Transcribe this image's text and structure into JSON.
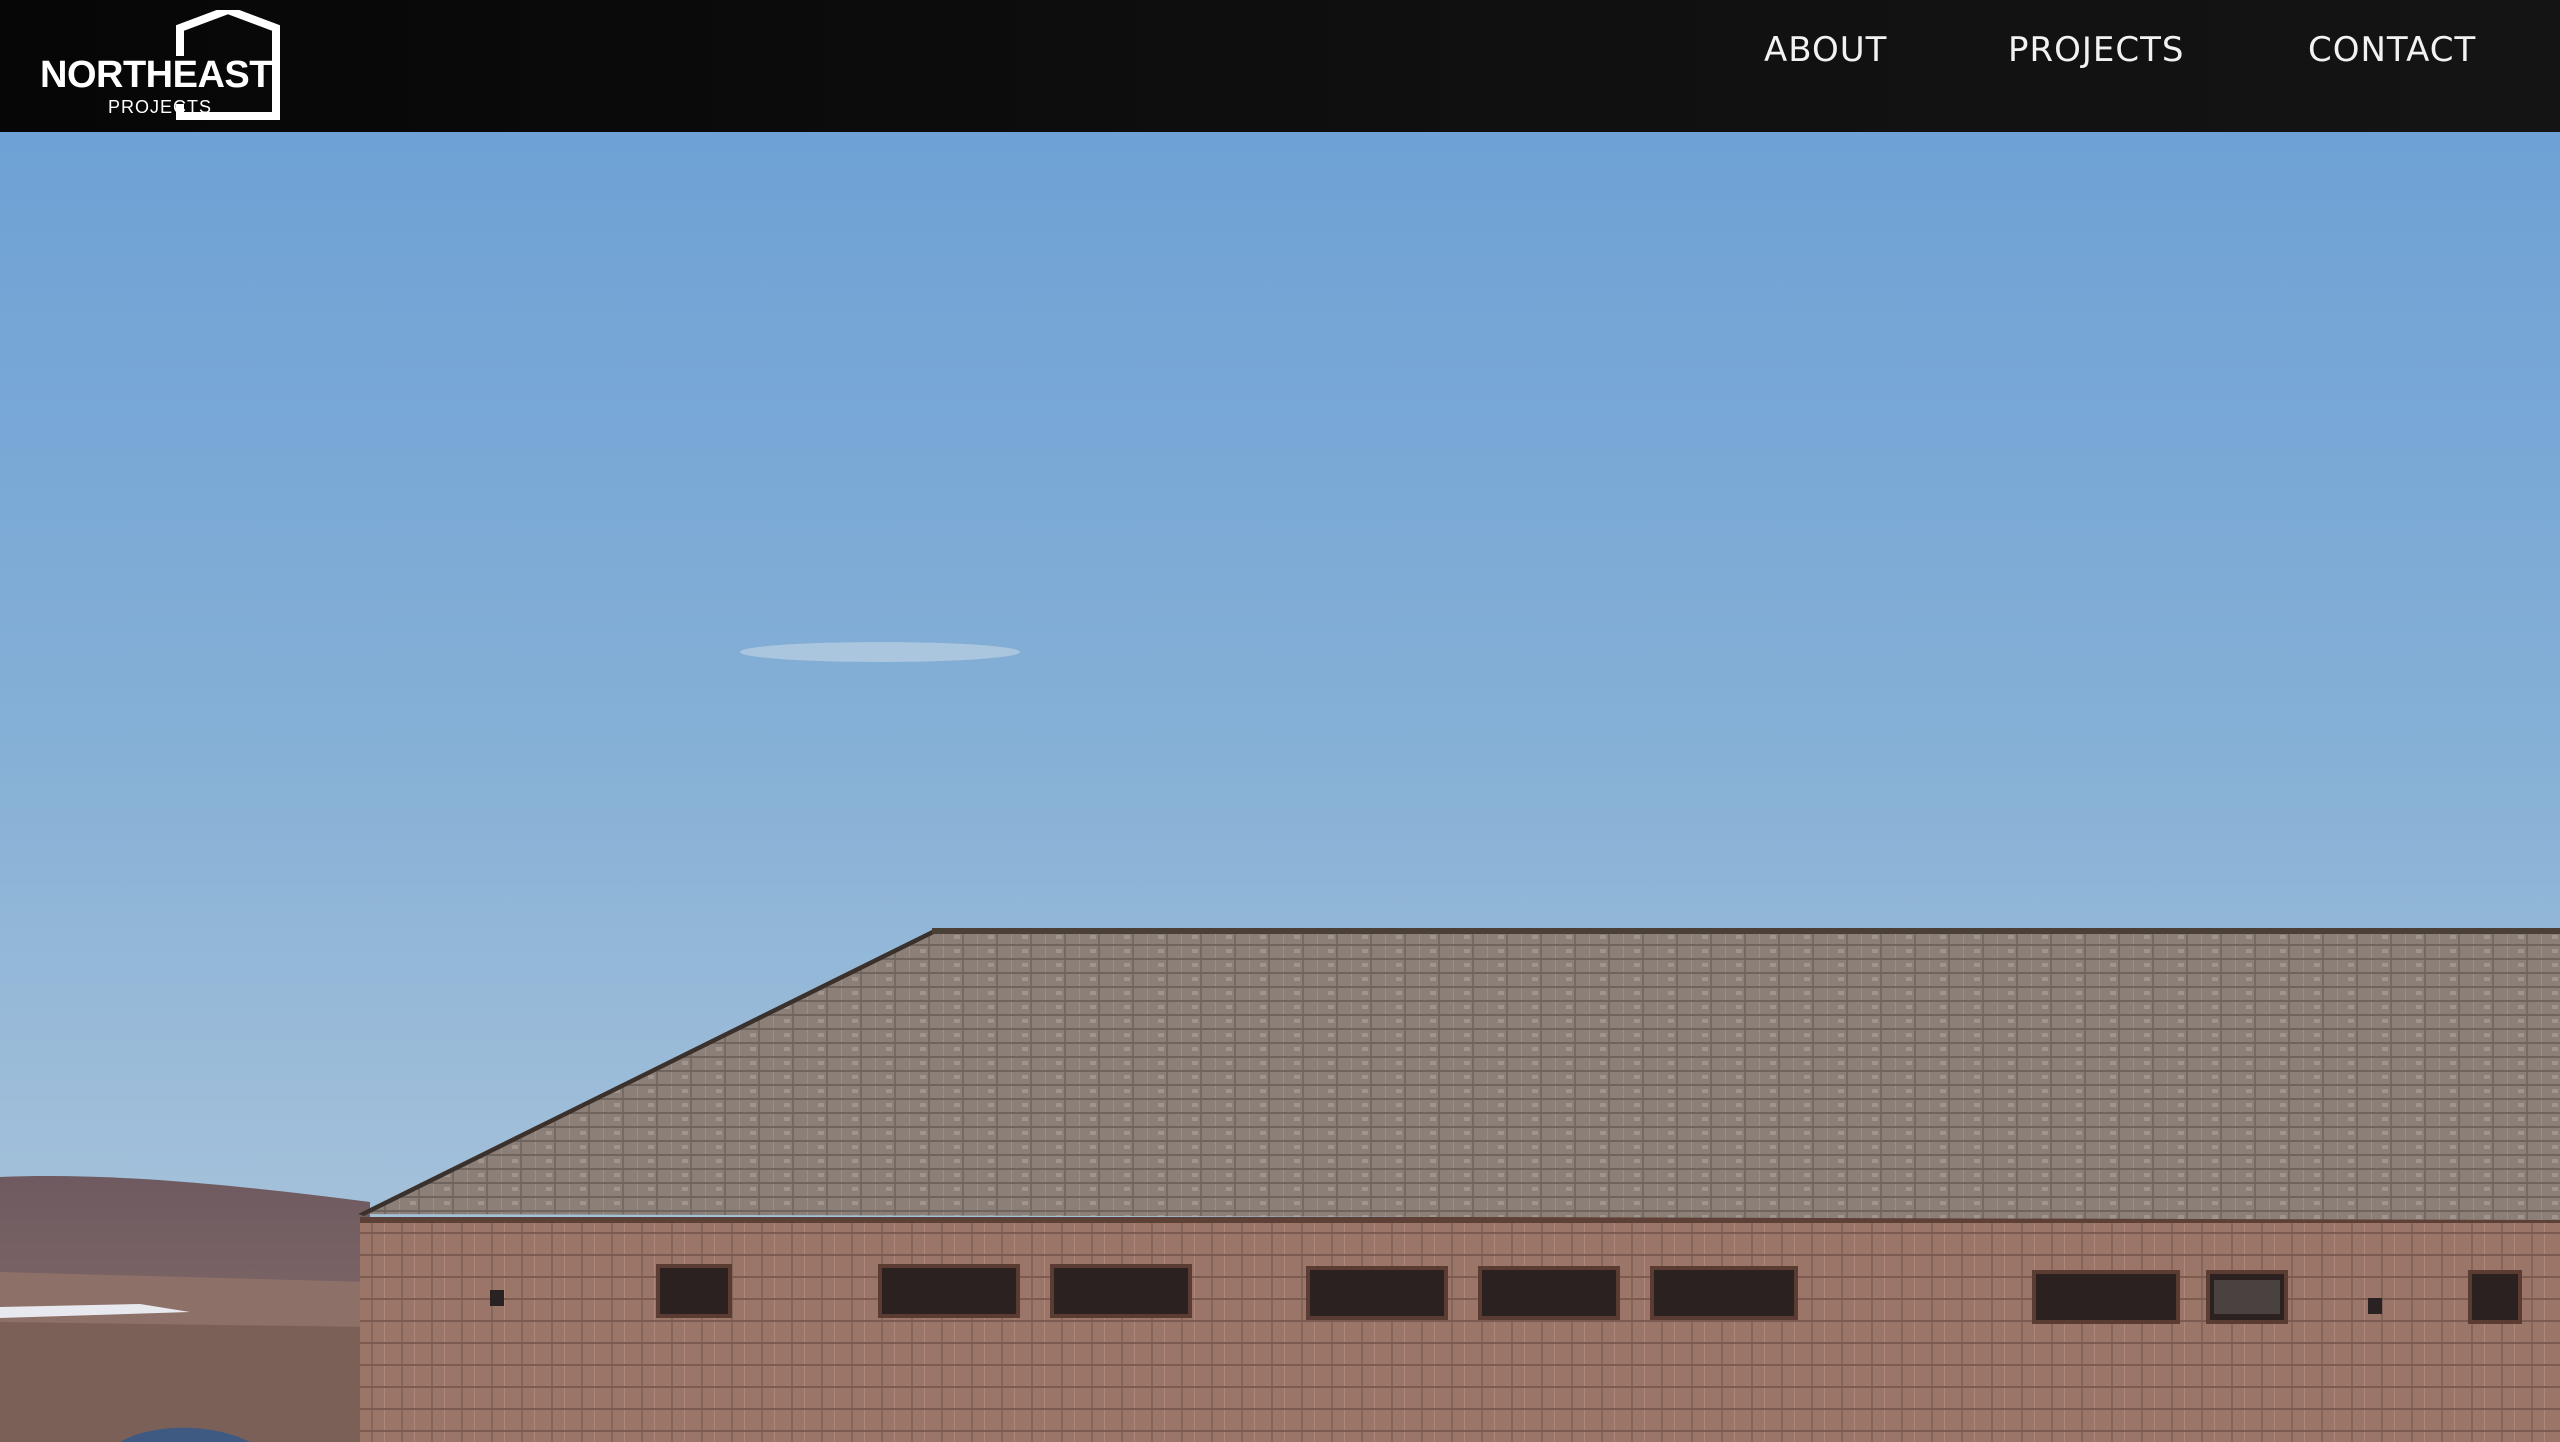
{
  "brand": {
    "name": "NORTHEAST",
    "sub": "PROJECTS",
    "icon": "house-outline-icon"
  },
  "nav": {
    "items": [
      {
        "label": "ABOUT"
      },
      {
        "label": "PROJECTS"
      },
      {
        "label": "CONTACT"
      }
    ]
  },
  "hero": {
    "description_icon": "hero-photo",
    "colors": {
      "sky_top": "#6fa2d6",
      "sky_bottom": "#a9c3d9",
      "roof": "#8a7d74",
      "wall": "#9a7466",
      "nav_bg": "#0b0b0b"
    }
  }
}
